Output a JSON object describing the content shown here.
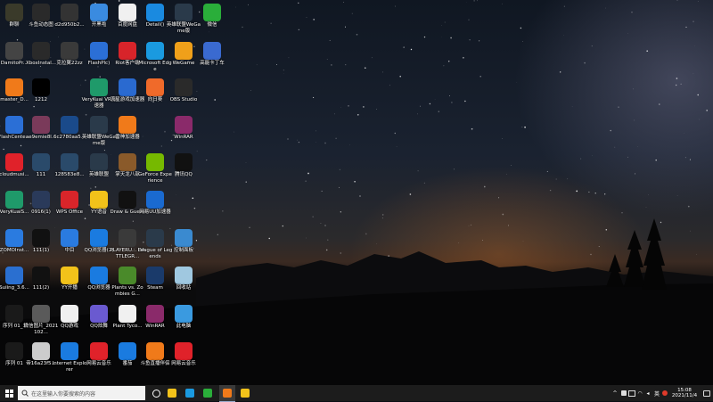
{
  "desktop_icons": [
    {
      "col": 0,
      "row": 0,
      "label": "群聊",
      "icon": "photo-icon",
      "color": "#3a3a2a"
    },
    {
      "col": 0,
      "row": 1,
      "label": "DamitoPr...",
      "icon": "image-icon",
      "color": "#444"
    },
    {
      "col": 0,
      "row": 2,
      "label": "master_D...",
      "icon": "archive-icon",
      "color": "#f07a1a"
    },
    {
      "col": 0,
      "row": 3,
      "label": "FlashCente...",
      "icon": "flash-icon",
      "color": "#2b6fd6"
    },
    {
      "col": 0,
      "row": 4,
      "label": "cloudmusi...",
      "icon": "netease-music-icon",
      "color": "#e0222a"
    },
    {
      "col": 0,
      "row": 5,
      "label": "VeryKuaiS...",
      "icon": "verykuai-icon",
      "color": "#1f9a6a"
    },
    {
      "col": 0,
      "row": 6,
      "label": "ZOMOInst...",
      "icon": "zomo-icon",
      "color": "#2a7be0"
    },
    {
      "col": 0,
      "row": 7,
      "label": "Suiing_3.6...",
      "icon": "suiing-icon",
      "color": "#2a6fd0"
    },
    {
      "col": 0,
      "row": 8,
      "label": "序列 01_1",
      "icon": "video-icon",
      "color": "#1a1a1a"
    },
    {
      "col": 0,
      "row": 9,
      "label": "序列 01",
      "icon": "video-icon",
      "color": "#1a1a1a"
    },
    {
      "col": 1,
      "row": 0,
      "label": "斗鱼动态图",
      "icon": "file-icon",
      "color": "#2a2a2a"
    },
    {
      "col": 1,
      "row": 1,
      "label": "XboxInstal...",
      "icon": "xbox-icon",
      "color": "#2a2a2a"
    },
    {
      "col": 1,
      "row": 3,
      "label": "ae9emie8l...",
      "icon": "image-icon",
      "color": "#7a3a5a"
    },
    {
      "col": 1,
      "row": 5,
      "label": "0916(1)",
      "icon": "image-icon",
      "color": "#2a3a5a"
    },
    {
      "col": 1,
      "row": 2,
      "label": "1212",
      "icon": "blank-icon",
      "color": "#000000"
    },
    {
      "col": 1,
      "row": 4,
      "label": "111",
      "icon": "image-icon",
      "color": "#2a4a6a"
    },
    {
      "col": 1,
      "row": 6,
      "label": "111(1)",
      "icon": "blank-icon",
      "color": "#111111"
    },
    {
      "col": 1,
      "row": 7,
      "label": "111(2)",
      "icon": "blank-icon",
      "color": "#111111"
    },
    {
      "col": 1,
      "row": 8,
      "label": "微信图片_2021102...",
      "icon": "image-icon",
      "color": "#5a5a5a"
    },
    {
      "col": 1,
      "row": 9,
      "label": "帝16a23f5...",
      "icon": "file-icon",
      "color": "#cccccc"
    },
    {
      "col": 2,
      "row": 0,
      "label": "d2d950b2...",
      "icon": "image-icon",
      "color": "#333"
    },
    {
      "col": 2,
      "row": 1,
      "label": "克拉翼22zz",
      "icon": "file-icon",
      "color": "#3a3a3a"
    },
    {
      "col": 2,
      "row": 3,
      "label": "6c2780aa5...",
      "icon": "image-icon",
      "color": "#1a4a8a"
    },
    {
      "col": 2,
      "row": 4,
      "label": "128583e8...",
      "icon": "image-icon",
      "color": "#2a4a6a"
    },
    {
      "col": 2,
      "row": 5,
      "label": "WPS Office",
      "icon": "wps-icon",
      "color": "#d9252a"
    },
    {
      "col": 2,
      "row": 6,
      "label": "中目",
      "icon": "zhongmu-icon",
      "color": "#2a7be0"
    },
    {
      "col": 2,
      "row": 7,
      "label": "YY开播",
      "icon": "yy-live-icon",
      "color": "#f2c21a"
    },
    {
      "col": 2,
      "row": 8,
      "label": "QQ游戏",
      "icon": "qq-game-icon",
      "color": "#f0f0f0"
    },
    {
      "col": 2,
      "row": 9,
      "label": "Internet Explorer",
      "icon": "ie-icon",
      "color": "#1a7be0"
    },
    {
      "col": 3,
      "row": 0,
      "label": "开黑啦",
      "icon": "kaiheila-icon",
      "color": "#3a8be0"
    },
    {
      "col": 3,
      "row": 1,
      "label": "FlashPlc)",
      "icon": "flash-icon",
      "color": "#2b6fd6"
    },
    {
      "col": 3,
      "row": 2,
      "label": "VeryKuai VR加速器",
      "icon": "verykuai-icon",
      "color": "#1f9a6a"
    },
    {
      "col": 3,
      "row": 3,
      "label": "英雄联盟WeGame版",
      "icon": "lol-icon",
      "color": "#2a3a4a"
    },
    {
      "col": 3,
      "row": 4,
      "label": "英雄联盟",
      "icon": "lol-icon",
      "color": "#2a3a4a"
    },
    {
      "col": 3,
      "row": 5,
      "label": "YY语音",
      "icon": "yy-icon",
      "color": "#f2c21a"
    },
    {
      "col": 3,
      "row": 6,
      "label": "QQ浏览器(2)",
      "icon": "qq-browser-icon",
      "color": "#1a7be0"
    },
    {
      "col": 3,
      "row": 7,
      "label": "QQ浏览器",
      "icon": "qq-browser-icon",
      "color": "#1a7be0"
    },
    {
      "col": 3,
      "row": 8,
      "label": "QQ炫舞",
      "icon": "qq-dance-icon",
      "color": "#6a5ad0"
    },
    {
      "col": 3,
      "row": 9,
      "label": "网易云音乐",
      "icon": "netease-music-icon",
      "color": "#e0222a"
    },
    {
      "col": 4,
      "row": 0,
      "label": "百度网盘",
      "icon": "baidu-pan-icon",
      "color": "#f0f0f0"
    },
    {
      "col": 4,
      "row": 1,
      "label": "Riot客户端",
      "icon": "riot-icon",
      "color": "#d8242a"
    },
    {
      "col": 4,
      "row": 2,
      "label": "流星游戏加速器",
      "icon": "liuxing-icon",
      "color": "#2a6ad0"
    },
    {
      "col": 4,
      "row": 3,
      "label": "雷神加速器",
      "icon": "leishen-icon",
      "color": "#f07a1a"
    },
    {
      "col": 4,
      "row": 4,
      "label": "掌天龙八部",
      "icon": "tlbb-icon",
      "color": "#8a5a2a"
    },
    {
      "col": 4,
      "row": 5,
      "label": "Draw & Guess",
      "icon": "draw-guess-icon",
      "color": "#111111"
    },
    {
      "col": 4,
      "row": 6,
      "label": "PLAYERU... BATTLEGR...",
      "icon": "pubg-icon",
      "color": "#3a3a3a"
    },
    {
      "col": 4,
      "row": 7,
      "label": "Plants vs. Zombies G...",
      "icon": "pvz-icon",
      "color": "#4a8a2a"
    },
    {
      "col": 4,
      "row": 8,
      "label": "Plant Tyco...",
      "icon": "file-icon",
      "color": "#f0f0f0"
    },
    {
      "col": 4,
      "row": 9,
      "label": "番茄",
      "icon": "tomato-icon",
      "color": "#1a7be0"
    },
    {
      "col": 5,
      "row": 0,
      "label": "Detail()",
      "icon": "globe-icon",
      "color": "#1a8ae0"
    },
    {
      "col": 5,
      "row": 1,
      "label": "Microsoft Edge",
      "icon": "edge-icon",
      "color": "#1a9ae0"
    },
    {
      "col": 5,
      "row": 2,
      "label": "向日葵",
      "icon": "sunflower-icon",
      "color": "#f06a2a"
    },
    {
      "col": 5,
      "row": 4,
      "label": "GeForce Experience",
      "icon": "nvidia-icon",
      "color": "#76b900"
    },
    {
      "col": 5,
      "row": 5,
      "label": "网易UU加速器",
      "icon": "uu-icon",
      "color": "#1a6ad0"
    },
    {
      "col": 5,
      "row": 6,
      "label": "League of Legends",
      "icon": "lol-icon",
      "color": "#2a3a4a"
    },
    {
      "col": 5,
      "row": 7,
      "label": "Steam",
      "icon": "steam-icon",
      "color": "#1a3a6a"
    },
    {
      "col": 5,
      "row": 8,
      "label": "WinRAR",
      "icon": "winrar-icon",
      "color": "#8a2a6a"
    },
    {
      "col": 5,
      "row": 9,
      "label": "斗鱼直播伴侣",
      "icon": "douyu-icon",
      "color": "#f07a1a"
    },
    {
      "col": 6,
      "row": 0,
      "label": "英雄联盟WeGame版",
      "icon": "lol-icon",
      "color": "#2a3a4a"
    },
    {
      "col": 6,
      "row": 1,
      "label": "WeGame",
      "icon": "wegame-icon",
      "color": "#f0a01a"
    },
    {
      "col": 6,
      "row": 2,
      "label": "OBS Studio",
      "icon": "obs-icon",
      "color": "#2a2a2a"
    },
    {
      "col": 6,
      "row": 3,
      "label": "WinRAR",
      "icon": "winrar-icon",
      "color": "#8a2a6a"
    },
    {
      "col": 6,
      "row": 4,
      "label": "腾讯QQ",
      "icon": "qq-icon",
      "color": "#111111"
    },
    {
      "col": 6,
      "row": 6,
      "label": "控制面板",
      "icon": "control-panel-icon",
      "color": "#3a8ad0"
    },
    {
      "col": 6,
      "row": 7,
      "label": "回收站",
      "icon": "recycle-bin-icon",
      "color": "#a0c8e0"
    },
    {
      "col": 6,
      "row": 8,
      "label": "此电脑",
      "icon": "this-pc-icon",
      "color": "#3a9ae0"
    },
    {
      "col": 6,
      "row": 9,
      "label": "网易云音乐",
      "icon": "netease-music-icon",
      "color": "#e0222a"
    },
    {
      "col": 7,
      "row": 0,
      "label": "微信",
      "icon": "wechat-icon",
      "color": "#2aae3a"
    },
    {
      "col": 7,
      "row": 1,
      "label": "高能卡丁车",
      "icon": "kart-icon",
      "color": "#3a6ad0"
    }
  ],
  "taskbar": {
    "search_placeholder": "在这里输入你要搜索的内容",
    "pinned": [
      {
        "name": "task-view-icon",
        "color": "#ffffff"
      },
      {
        "name": "file-explorer-icon",
        "color": "#f2c21a"
      },
      {
        "name": "edge-taskbar-icon",
        "color": "#1a9ae0"
      },
      {
        "name": "wechat-taskbar-icon",
        "color": "#2aae3a"
      },
      {
        "name": "app-taskbar-icon",
        "color": "#f07a1a"
      },
      {
        "name": "yy-taskbar-icon",
        "color": "#f2c21a"
      }
    ],
    "tray_time": "15:08",
    "tray_date": "2021/11/4",
    "ime": "英"
  }
}
